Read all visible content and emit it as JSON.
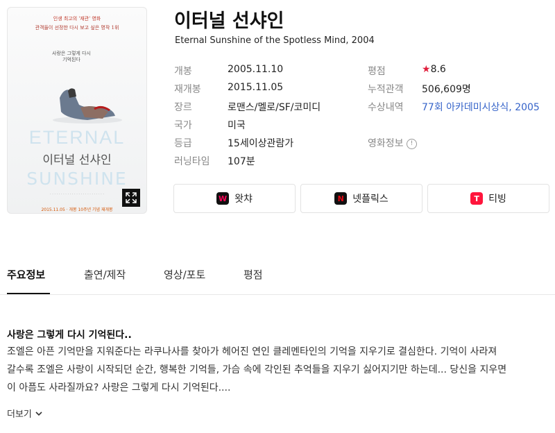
{
  "poster": {
    "tagline_top": "인생 최고의 '재관' 영화",
    "tagline_sub": "관객들이 선정한 다시 보고 싶은 명작 1위",
    "vertical_text": "사랑은 그렇게 다시 기억된다",
    "title_en_1": "ETERNAL",
    "title_kr": "이터널 선샤인",
    "title_en_2": "SUNSHINE",
    "release_note": "2015.11.05 · 개봉 10주년 기념 재개봉",
    "expand_icon": "expand-icon"
  },
  "movie": {
    "title": "이터널 선샤인",
    "subtitle": "Eternal Sunshine of the Spotless Mind, 2004"
  },
  "info_left": [
    {
      "label": "개봉",
      "value": "2005.11.10"
    },
    {
      "label": "재개봉",
      "value": "2015.11.05"
    },
    {
      "label": "장르",
      "value": "로맨스/멜로/SF/코미디"
    },
    {
      "label": "국가",
      "value": "미국"
    },
    {
      "label": "등급",
      "value": "15세이상관람가"
    },
    {
      "label": "러닝타임",
      "value": "107분"
    }
  ],
  "info_right": {
    "rating_label": "평점",
    "rating_star": "★",
    "rating_value": "8.6",
    "audience_label": "누적관객",
    "audience_value": "506,609명",
    "awards_label": "수상내역",
    "awards_value": "77회 아카데미시상식, 2005",
    "movieinfo_label": "영화정보",
    "movieinfo_icon": "!"
  },
  "streaming": [
    {
      "label": "왓챠",
      "icon": "watcha-icon",
      "glyph": "W",
      "bg": "#111111",
      "fg": "#ff0558"
    },
    {
      "label": "넷플릭스",
      "icon": "netflix-icon",
      "glyph": "N",
      "bg": "#111111",
      "fg": "#e50914"
    },
    {
      "label": "티빙",
      "icon": "tving-icon",
      "glyph": "T",
      "bg": "#ff153c",
      "fg": "#ffffff"
    }
  ],
  "tabs": [
    {
      "label": "주요정보",
      "active": true
    },
    {
      "label": "출연/제작",
      "active": false
    },
    {
      "label": "영상/포토",
      "active": false
    },
    {
      "label": "평점",
      "active": false
    }
  ],
  "synopsis": {
    "tagline": "사랑은 그렇게 다시 기억된다..",
    "line1": "조엘은 아픈 기억만을 지워준다는 라쿠나사를 찾아가 헤어진 연인 클레멘타인의 기억을 지우기로 결심한다. 기억이 사라져",
    "line2": "갈수록 조엘은 사랑이 시작되던 순간, 행복한 기억들, 가슴 속에 각인된 추억들을 지우기 싫어지기만 하는데... 당신을 지우면",
    "line3": "이 아픔도 사라질까요? 사랑은 그렇게 다시 기억된다....",
    "more_label": "더보기"
  },
  "colors": {
    "link": "#3563c9",
    "star": "#e01e3c"
  }
}
